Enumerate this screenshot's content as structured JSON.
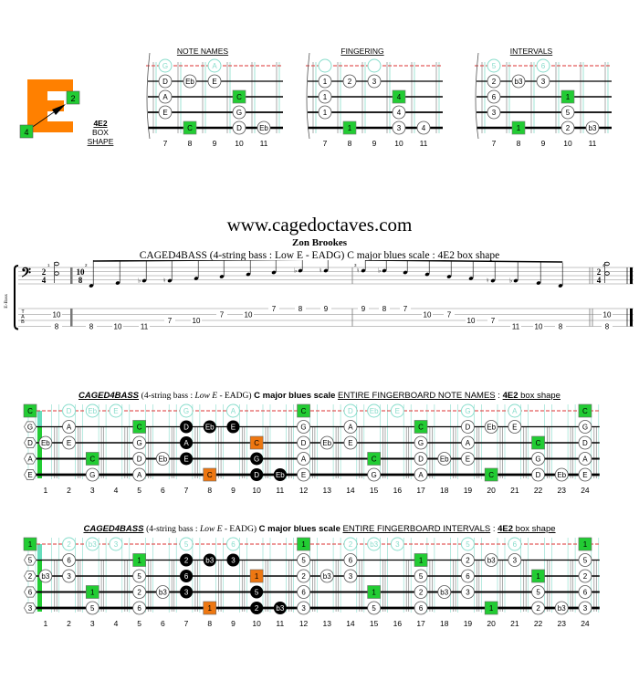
{
  "box_shape": {
    "label_line1": "4E2",
    "label_line2": "BOX",
    "label_line3": "SHAPE",
    "letter": "E",
    "letter_color": "#ff8000",
    "finger_start": "4",
    "finger_end": "2"
  },
  "mini_diagrams": [
    {
      "title": "NOTE NAMES",
      "frets": [
        "7",
        "8",
        "9",
        "10",
        "11"
      ],
      "open_row": [
        {
          "fret": "7",
          "text": "G"
        },
        {
          "fret": "9",
          "text": "A"
        }
      ],
      "strings": [
        [
          {
            "fret": "7",
            "text": "D"
          },
          {
            "fret": "8",
            "text": "Eb"
          },
          {
            "fret": "9",
            "text": "E"
          }
        ],
        [
          {
            "fret": "7",
            "text": "A"
          },
          {
            "fret": "10",
            "text": "C",
            "root": true
          }
        ],
        [
          {
            "fret": "7",
            "text": "E"
          },
          {
            "fret": "10",
            "text": "G"
          }
        ],
        [
          {
            "fret": "8",
            "text": "C",
            "root": true
          },
          {
            "fret": "10",
            "text": "D"
          },
          {
            "fret": "11",
            "text": "Eb"
          }
        ]
      ]
    },
    {
      "title": "FINGERING",
      "frets": [
        "7",
        "8",
        "9",
        "10",
        "11"
      ],
      "open_row": [
        {
          "fret": "7",
          "text": ""
        },
        {
          "fret": "9",
          "text": ""
        }
      ],
      "strings": [
        [
          {
            "fret": "7",
            "text": "1"
          },
          {
            "fret": "8",
            "text": "2"
          },
          {
            "fret": "9",
            "text": "3"
          }
        ],
        [
          {
            "fret": "7",
            "text": "1"
          },
          {
            "fret": "10",
            "text": "4",
            "root": true
          }
        ],
        [
          {
            "fret": "7",
            "text": "1"
          },
          {
            "fret": "10",
            "text": "4"
          }
        ],
        [
          {
            "fret": "8",
            "text": "1",
            "root": true
          },
          {
            "fret": "10",
            "text": "3"
          },
          {
            "fret": "11",
            "text": "4"
          }
        ]
      ]
    },
    {
      "title": "INTERVALS",
      "frets": [
        "7",
        "8",
        "9",
        "10",
        "11"
      ],
      "open_row": [
        {
          "fret": "7",
          "text": "5"
        },
        {
          "fret": "9",
          "text": "6"
        }
      ],
      "strings": [
        [
          {
            "fret": "7",
            "text": "2"
          },
          {
            "fret": "8",
            "text": "b3"
          },
          {
            "fret": "9",
            "text": "3"
          }
        ],
        [
          {
            "fret": "7",
            "text": "6"
          },
          {
            "fret": "10",
            "text": "1",
            "root": true
          }
        ],
        [
          {
            "fret": "7",
            "text": "3"
          },
          {
            "fret": "10",
            "text": "5"
          }
        ],
        [
          {
            "fret": "8",
            "text": "1",
            "root": true
          },
          {
            "fret": "10",
            "text": "2"
          },
          {
            "fret": "11",
            "text": "b3"
          }
        ]
      ]
    }
  ],
  "header": {
    "site": "www.cagedoctaves.com",
    "author": "Zon Brookes",
    "subtitle": "CAGED4BASS (4-string bass : Low E - EADG) C major blues scale : 4E2 box shape"
  },
  "score": {
    "instrument": "E-Bass",
    "tab_letters": [
      "T",
      "A",
      "B"
    ],
    "measures": [
      {
        "number": "1",
        "time_sig": [
          "2",
          "4"
        ],
        "tab": [
          {
            "string": "D",
            "fret": "10"
          },
          {
            "string": "E",
            "fret": "8"
          }
        ]
      },
      {
        "number": "2",
        "time_sig": [
          "10",
          "8"
        ],
        "tab": [
          {
            "string": "E",
            "fret": "8"
          },
          {
            "string": "E",
            "fret": "10"
          },
          {
            "string": "E",
            "fret": "11"
          },
          {
            "string": "A",
            "fret": "7"
          },
          {
            "string": "A",
            "fret": "10"
          },
          {
            "string": "D",
            "fret": "7"
          },
          {
            "string": "D",
            "fret": "10"
          },
          {
            "string": "G",
            "fret": "7"
          },
          {
            "string": "G",
            "fret": "8"
          },
          {
            "string": "G",
            "fret": "9"
          }
        ]
      },
      {
        "number": "3",
        "time_sig": null,
        "tab": [
          {
            "string": "G",
            "fret": "9"
          },
          {
            "string": "G",
            "fret": "8"
          },
          {
            "string": "G",
            "fret": "7"
          },
          {
            "string": "D",
            "fret": "10"
          },
          {
            "string": "D",
            "fret": "7"
          },
          {
            "string": "A",
            "fret": "10"
          },
          {
            "string": "A",
            "fret": "7"
          },
          {
            "string": "E",
            "fret": "11"
          },
          {
            "string": "E",
            "fret": "10"
          },
          {
            "string": "E",
            "fret": "8"
          }
        ]
      },
      {
        "number": "4",
        "time_sig": [
          "2",
          "4"
        ],
        "tab": [
          {
            "string": "D",
            "fret": "10"
          },
          {
            "string": "E",
            "fret": "8"
          }
        ]
      }
    ]
  },
  "fingerboard_notes": {
    "title_brand": "CAGED4BASS",
    "title_desc_pre": "(4-string bass : ",
    "title_desc_low": "Low E",
    "title_desc_post": " - EADG)",
    "title_scale": "C major blues scale",
    "title_section": "ENTIRE FINGERBOARD  NOTE NAMES",
    "title_sep": " : ",
    "title_shape": "4E2",
    "title_shape_suffix": " box shape",
    "fret_numbers": [
      "1",
      "2",
      "3",
      "4",
      "5",
      "6",
      "7",
      "8",
      "9",
      "10",
      "11",
      "12",
      "13",
      "14",
      "15",
      "16",
      "17",
      "18",
      "19",
      "20",
      "21",
      "22",
      "23",
      "24"
    ],
    "open_strings": [
      "C",
      "G",
      "D",
      "A",
      "E"
    ],
    "top_row": [
      {
        "fret": 2,
        "text": "D"
      },
      {
        "fret": 3,
        "text": "Eb"
      },
      {
        "fret": 4,
        "text": "E"
      },
      {
        "fret": 7,
        "text": "G"
      },
      {
        "fret": 9,
        "text": "A"
      },
      {
        "fret": 12,
        "text": "C",
        "type": "root"
      },
      {
        "fret": 14,
        "text": "D"
      },
      {
        "fret": 15,
        "text": "Eb"
      },
      {
        "fret": 16,
        "text": "E"
      },
      {
        "fret": 19,
        "text": "G"
      },
      {
        "fret": 21,
        "text": "A"
      },
      {
        "fret": 24,
        "text": "C",
        "type": "root"
      }
    ],
    "strings": [
      [
        {
          "fret": 2,
          "text": "A"
        },
        {
          "fret": 5,
          "text": "C",
          "type": "root"
        },
        {
          "fret": 7,
          "text": "D",
          "type": "box"
        },
        {
          "fret": 8,
          "text": "Eb",
          "type": "box"
        },
        {
          "fret": 9,
          "text": "E",
          "type": "box"
        },
        {
          "fret": 12,
          "text": "G"
        },
        {
          "fret": 14,
          "text": "A"
        },
        {
          "fret": 17,
          "text": "C",
          "type": "root"
        },
        {
          "fret": 19,
          "text": "D"
        },
        {
          "fret": 20,
          "text": "Eb"
        },
        {
          "fret": 21,
          "text": "E"
        },
        {
          "fret": 24,
          "text": "G"
        }
      ],
      [
        {
          "fret": 1,
          "text": "Eb"
        },
        {
          "fret": 2,
          "text": "E"
        },
        {
          "fret": 5,
          "text": "G"
        },
        {
          "fret": 7,
          "text": "A",
          "type": "box"
        },
        {
          "fret": 10,
          "text": "C",
          "type": "boxroot"
        },
        {
          "fret": 12,
          "text": "D"
        },
        {
          "fret": 13,
          "text": "Eb"
        },
        {
          "fret": 14,
          "text": "E"
        },
        {
          "fret": 17,
          "text": "G"
        },
        {
          "fret": 19,
          "text": "A"
        },
        {
          "fret": 22,
          "text": "C",
          "type": "root"
        },
        {
          "fret": 24,
          "text": "D"
        }
      ],
      [
        {
          "fret": 3,
          "text": "C",
          "type": "root"
        },
        {
          "fret": 5,
          "text": "D"
        },
        {
          "fret": 6,
          "text": "Eb"
        },
        {
          "fret": 7,
          "text": "E",
          "type": "box"
        },
        {
          "fret": 10,
          "text": "G",
          "type": "box"
        },
        {
          "fret": 12,
          "text": "A"
        },
        {
          "fret": 15,
          "text": "C",
          "type": "root"
        },
        {
          "fret": 17,
          "text": "D"
        },
        {
          "fret": 18,
          "text": "Eb"
        },
        {
          "fret": 19,
          "text": "E"
        },
        {
          "fret": 22,
          "text": "G"
        },
        {
          "fret": 24,
          "text": "A"
        }
      ],
      [
        {
          "fret": 3,
          "text": "G"
        },
        {
          "fret": 5,
          "text": "A"
        },
        {
          "fret": 8,
          "text": "C",
          "type": "boxroot"
        },
        {
          "fret": 10,
          "text": "D",
          "type": "box"
        },
        {
          "fret": 11,
          "text": "Eb",
          "type": "box"
        },
        {
          "fret": 12,
          "text": "E"
        },
        {
          "fret": 15,
          "text": "G"
        },
        {
          "fret": 17,
          "text": "A"
        },
        {
          "fret": 20,
          "text": "C",
          "type": "root"
        },
        {
          "fret": 22,
          "text": "D"
        },
        {
          "fret": 23,
          "text": "Eb"
        },
        {
          "fret": 24,
          "text": "E"
        }
      ]
    ]
  },
  "fingerboard_intervals": {
    "title_brand": "CAGED4BASS",
    "title_desc_pre": "(4-string bass : ",
    "title_desc_low": "Low E",
    "title_desc_post": " - EADG)",
    "title_scale": "C major blues scale",
    "title_section": "ENTIRE FINGERBOARD  INTERVALS",
    "title_sep": " : ",
    "title_shape": "4E2",
    "title_shape_suffix": " box shape",
    "fret_numbers": [
      "1",
      "2",
      "3",
      "4",
      "5",
      "6",
      "7",
      "8",
      "9",
      "10",
      "11",
      "12",
      "13",
      "14",
      "15",
      "16",
      "17",
      "18",
      "19",
      "20",
      "21",
      "22",
      "23",
      "24"
    ],
    "open_strings": [
      "1",
      "5",
      "2",
      "6",
      "3"
    ],
    "top_row": [
      {
        "fret": 2,
        "text": "2"
      },
      {
        "fret": 3,
        "text": "b3"
      },
      {
        "fret": 4,
        "text": "3"
      },
      {
        "fret": 7,
        "text": "5"
      },
      {
        "fret": 9,
        "text": "6"
      },
      {
        "fret": 12,
        "text": "1",
        "type": "root"
      },
      {
        "fret": 14,
        "text": "2"
      },
      {
        "fret": 15,
        "text": "b3"
      },
      {
        "fret": 16,
        "text": "3"
      },
      {
        "fret": 19,
        "text": "5"
      },
      {
        "fret": 21,
        "text": "6"
      },
      {
        "fret": 24,
        "text": "1",
        "type": "root"
      }
    ],
    "strings": [
      [
        {
          "fret": 2,
          "text": "6"
        },
        {
          "fret": 5,
          "text": "1",
          "type": "root"
        },
        {
          "fret": 7,
          "text": "2",
          "type": "box"
        },
        {
          "fret": 8,
          "text": "b3",
          "type": "box"
        },
        {
          "fret": 9,
          "text": "3",
          "type": "box"
        },
        {
          "fret": 12,
          "text": "5"
        },
        {
          "fret": 14,
          "text": "6"
        },
        {
          "fret": 17,
          "text": "1",
          "type": "root"
        },
        {
          "fret": 19,
          "text": "2"
        },
        {
          "fret": 20,
          "text": "b3"
        },
        {
          "fret": 21,
          "text": "3"
        },
        {
          "fret": 24,
          "text": "5"
        }
      ],
      [
        {
          "fret": 1,
          "text": "b3"
        },
        {
          "fret": 2,
          "text": "3"
        },
        {
          "fret": 5,
          "text": "5"
        },
        {
          "fret": 7,
          "text": "6",
          "type": "box"
        },
        {
          "fret": 10,
          "text": "1",
          "type": "boxroot"
        },
        {
          "fret": 12,
          "text": "2"
        },
        {
          "fret": 13,
          "text": "b3"
        },
        {
          "fret": 14,
          "text": "3"
        },
        {
          "fret": 17,
          "text": "5"
        },
        {
          "fret": 19,
          "text": "6"
        },
        {
          "fret": 22,
          "text": "1",
          "type": "root"
        },
        {
          "fret": 24,
          "text": "2"
        }
      ],
      [
        {
          "fret": 3,
          "text": "1",
          "type": "root"
        },
        {
          "fret": 5,
          "text": "2"
        },
        {
          "fret": 6,
          "text": "b3"
        },
        {
          "fret": 7,
          "text": "3",
          "type": "box"
        },
        {
          "fret": 10,
          "text": "5",
          "type": "box"
        },
        {
          "fret": 12,
          "text": "6"
        },
        {
          "fret": 15,
          "text": "1",
          "type": "root"
        },
        {
          "fret": 17,
          "text": "2"
        },
        {
          "fret": 18,
          "text": "b3"
        },
        {
          "fret": 19,
          "text": "3"
        },
        {
          "fret": 22,
          "text": "5"
        },
        {
          "fret": 24,
          "text": "6"
        }
      ],
      [
        {
          "fret": 3,
          "text": "5"
        },
        {
          "fret": 5,
          "text": "6"
        },
        {
          "fret": 8,
          "text": "1",
          "type": "boxroot"
        },
        {
          "fret": 10,
          "text": "2",
          "type": "box"
        },
        {
          "fret": 11,
          "text": "b3",
          "type": "box"
        },
        {
          "fret": 12,
          "text": "3"
        },
        {
          "fret": 15,
          "text": "5"
        },
        {
          "fret": 17,
          "text": "6"
        },
        {
          "fret": 20,
          "text": "1",
          "type": "root"
        },
        {
          "fret": 22,
          "text": "2"
        },
        {
          "fret": 23,
          "text": "b3"
        },
        {
          "fret": 24,
          "text": "3"
        }
      ]
    ]
  },
  "colors": {
    "root": "#22cc33",
    "box_root": "#ee7711",
    "box_note": "#000000",
    "ghost": "#88ddcc",
    "dashed": "#dd3333",
    "nut": "#22cc33"
  }
}
